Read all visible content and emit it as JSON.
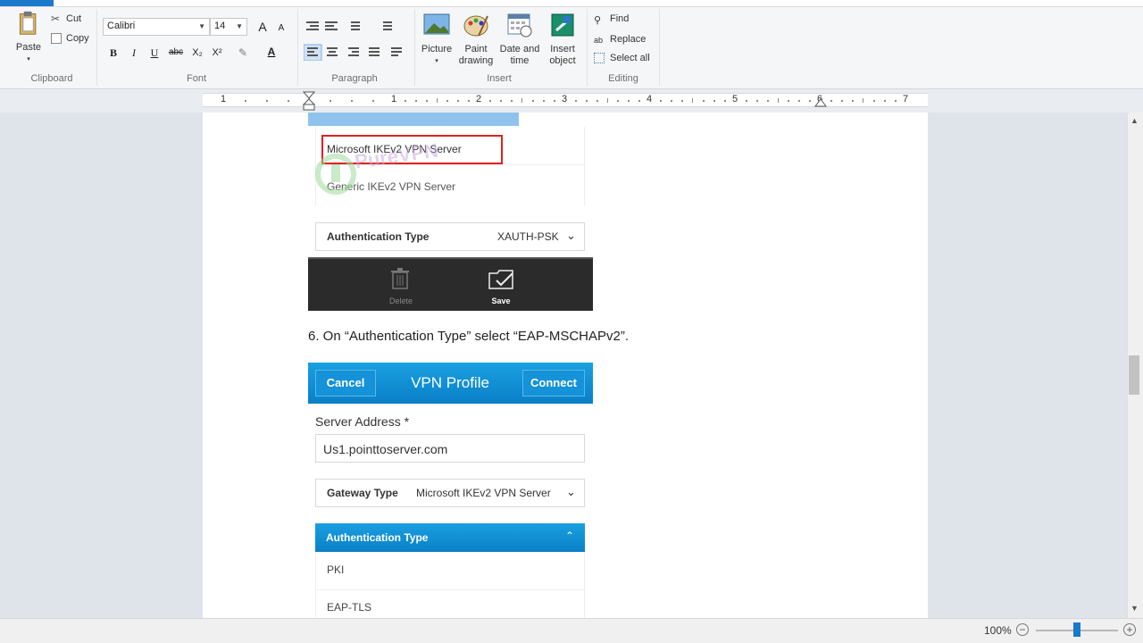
{
  "ribbon": {
    "clipboard": {
      "paste": "Paste",
      "cut": "Cut",
      "copy": "Copy",
      "label": "Clipboard"
    },
    "font": {
      "family": "Calibri",
      "size": "14",
      "label": "Font",
      "bold": "B",
      "italic": "I",
      "underline": "U",
      "strike": "abc",
      "sub": "X₂",
      "sup": "X²",
      "color_letter": "A",
      "grow": "A",
      "shrink": "A"
    },
    "paragraph": {
      "label": "Paragraph"
    },
    "insert": {
      "label": "Insert",
      "picture": "Picture",
      "paint_line1": "Paint",
      "paint_line2": "drawing",
      "datetime_line1": "Date and",
      "datetime_line2": "time",
      "object_line1": "Insert",
      "object_line2": "object"
    },
    "editing": {
      "label": "Editing",
      "find": "Find",
      "replace": "Replace",
      "select_all": "Select all"
    }
  },
  "ruler": {
    "numbers": [
      "1",
      "1",
      "2",
      "3",
      "4",
      "5",
      "6",
      "7"
    ]
  },
  "document": {
    "server_option_selected": "Microsoft IKEv2 VPN Server",
    "server_option_other": "Generic IKEv2 VPN Server",
    "watermark": "PureVPN",
    "auth_label_1": "Authentication Type",
    "auth_value_1": "XAUTH-PSK",
    "delete_label": "Delete",
    "save_label": "Save",
    "step_text": "6. On “Authentication Type” select “EAP-MSCHAPv2”.",
    "profile": {
      "cancel": "Cancel",
      "title": "VPN Profile",
      "connect": "Connect",
      "server_address_label": "Server Address *",
      "server_address_value": "Us1.pointtoserver.com",
      "gateway_label": "Gateway Type",
      "gateway_value": "Microsoft IKEv2 VPN Server",
      "auth_label": "Authentication Type",
      "options": [
        "PKI",
        "EAP-TLS"
      ]
    }
  },
  "status": {
    "zoom": "100%",
    "zoom_level_percent": 100
  },
  "colors": {
    "accent": "#1979ca",
    "highlight_red": "#e02020",
    "toolbar_dark": "#2b2b2b",
    "header_blue": "#0a87d0"
  }
}
